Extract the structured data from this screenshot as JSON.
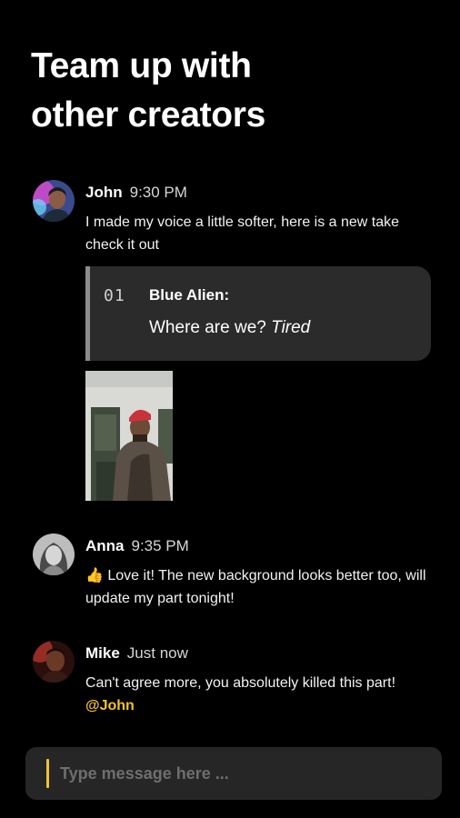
{
  "headline": {
    "line1": "Team up with",
    "line2": "other creators"
  },
  "messages": [
    {
      "name": "John",
      "time": "9:30 PM",
      "text": "I made my voice a little softer, here is a new take check it out",
      "avatar": "man-with-neon-light"
    },
    {
      "name": "Anna",
      "time": "9:35 PM",
      "emoji": "👍",
      "text": "Love it! The new background looks better too, will update my part tonight!",
      "avatar": "woman-grayscale"
    },
    {
      "name": "Mike",
      "time": "Just now",
      "text": "Can't agree more, you absolutely killed this part!",
      "mention": "@John",
      "avatar": "man-red-light"
    }
  ],
  "quote": {
    "number": "01",
    "character": "Blue Alien:",
    "line_plain": "Where are we?",
    "line_italic": "Tired"
  },
  "attachment": {
    "type": "photo",
    "subject": "man in red cap"
  },
  "composer": {
    "placeholder": "Type message here ..."
  },
  "colors": {
    "background": "#000000",
    "accent": "#f2c230",
    "card": "#2b2b2b",
    "composer": "#262626"
  }
}
